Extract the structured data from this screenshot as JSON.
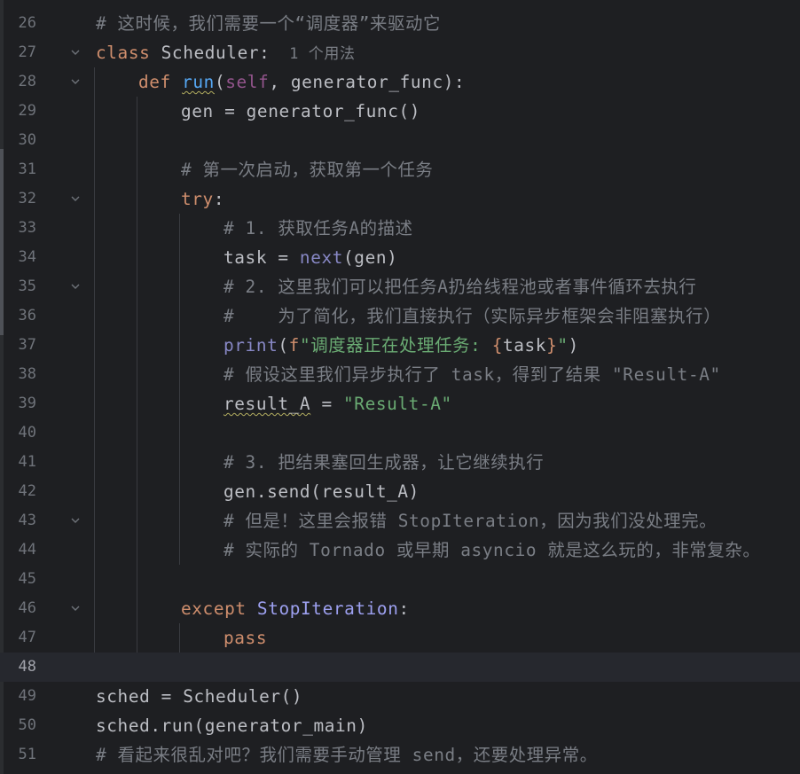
{
  "editor": {
    "lines": [
      {
        "number": "26",
        "fold": false,
        "indent": 0,
        "tokens": [
          {
            "t": "cmt",
            "v": "# 这时候，我们需要一个“调度器”来驱动它"
          }
        ]
      },
      {
        "number": "27",
        "fold": true,
        "indent": 0,
        "tokens": [
          {
            "t": "kw",
            "v": "class "
          },
          {
            "t": "plain",
            "v": "Scheduler:"
          },
          {
            "t": "hint",
            "v": "  1 个用法"
          }
        ]
      },
      {
        "number": "28",
        "fold": true,
        "indent": 1,
        "tokens": [
          {
            "t": "kw",
            "v": "def "
          },
          {
            "t": "fn_u",
            "v": "run"
          },
          {
            "t": "plain",
            "v": "("
          },
          {
            "t": "self",
            "v": "self"
          },
          {
            "t": "plain",
            "v": ", generator_func):"
          }
        ]
      },
      {
        "number": "29",
        "fold": false,
        "indent": 2,
        "tokens": [
          {
            "t": "plain",
            "v": "gen = generator_func()"
          }
        ]
      },
      {
        "number": "30",
        "fold": false,
        "indent": 0,
        "tokens": []
      },
      {
        "number": "31",
        "fold": false,
        "indent": 2,
        "tokens": [
          {
            "t": "cmt",
            "v": "# 第一次启动，获取第一个任务"
          }
        ]
      },
      {
        "number": "32",
        "fold": true,
        "indent": 2,
        "tokens": [
          {
            "t": "kw",
            "v": "try"
          },
          {
            "t": "plain",
            "v": ":"
          }
        ]
      },
      {
        "number": "33",
        "fold": false,
        "indent": 3,
        "tokens": [
          {
            "t": "cmt",
            "v": "# 1. 获取任务A的描述"
          }
        ]
      },
      {
        "number": "34",
        "fold": false,
        "indent": 3,
        "tokens": [
          {
            "t": "plain",
            "v": "task = "
          },
          {
            "t": "builtin",
            "v": "next"
          },
          {
            "t": "plain",
            "v": "(gen)"
          }
        ]
      },
      {
        "number": "35",
        "fold": true,
        "indent": 3,
        "tokens": [
          {
            "t": "cmt",
            "v": "# 2. 这里我们可以把任务A扔给线程池或者事件循环去执行"
          }
        ]
      },
      {
        "number": "36",
        "fold": false,
        "indent": 3,
        "tokens": [
          {
            "t": "cmt",
            "v": "#    为了简化，我们直接执行（实际异步框架会非阻塞执行）"
          }
        ]
      },
      {
        "number": "37",
        "fold": false,
        "indent": 3,
        "tokens": [
          {
            "t": "builtin",
            "v": "print"
          },
          {
            "t": "plain",
            "v": "("
          },
          {
            "t": "kw",
            "v": "f"
          },
          {
            "t": "str",
            "v": "\"调度器正在处理任务: "
          },
          {
            "t": "kw",
            "v": "{"
          },
          {
            "t": "plain",
            "v": "task"
          },
          {
            "t": "kw",
            "v": "}"
          },
          {
            "t": "str",
            "v": "\""
          },
          {
            "t": "plain",
            "v": ")"
          }
        ]
      },
      {
        "number": "38",
        "fold": false,
        "indent": 3,
        "tokens": [
          {
            "t": "cmt",
            "v": "# 假设这里我们异步执行了 task，得到了结果 \"Result-A\""
          }
        ]
      },
      {
        "number": "39",
        "fold": false,
        "indent": 3,
        "tokens": [
          {
            "t": "under",
            "v": "result_A"
          },
          {
            "t": "plain",
            "v": " = "
          },
          {
            "t": "str",
            "v": "\"Result-A\""
          }
        ]
      },
      {
        "number": "40",
        "fold": false,
        "indent": 0,
        "tokens": []
      },
      {
        "number": "41",
        "fold": false,
        "indent": 3,
        "tokens": [
          {
            "t": "cmt",
            "v": "# 3. 把结果塞回生成器，让它继续执行"
          }
        ]
      },
      {
        "number": "42",
        "fold": false,
        "indent": 3,
        "tokens": [
          {
            "t": "plain",
            "v": "gen.send(result_A)"
          }
        ]
      },
      {
        "number": "43",
        "fold": true,
        "indent": 3,
        "tokens": [
          {
            "t": "cmt",
            "v": "# 但是！这里会报错 StopIteration，因为我们没处理完。"
          }
        ]
      },
      {
        "number": "44",
        "fold": false,
        "indent": 3,
        "tokens": [
          {
            "t": "cmt",
            "v": "# 实际的 Tornado 或早期 asyncio 就是这么玩的，非常复杂。"
          }
        ]
      },
      {
        "number": "45",
        "fold": false,
        "indent": 0,
        "tokens": []
      },
      {
        "number": "46",
        "fold": true,
        "indent": 2,
        "tokens": [
          {
            "t": "kw",
            "v": "except "
          },
          {
            "t": "cls",
            "v": "StopIteration"
          },
          {
            "t": "plain",
            "v": ":"
          }
        ]
      },
      {
        "number": "47",
        "fold": false,
        "indent": 3,
        "tokens": [
          {
            "t": "kw",
            "v": "pass"
          }
        ]
      },
      {
        "number": "48",
        "fold": false,
        "indent": 0,
        "current": true,
        "tokens": []
      },
      {
        "number": "49",
        "fold": false,
        "indent": 0,
        "tokens": [
          {
            "t": "plain",
            "v": "sched = Scheduler()"
          }
        ]
      },
      {
        "number": "50",
        "fold": false,
        "indent": 0,
        "tokens": [
          {
            "t": "plain",
            "v": "sched.run(generator_main)"
          }
        ]
      },
      {
        "number": "51",
        "fold": false,
        "indent": 0,
        "tokens": [
          {
            "t": "cmt",
            "v": "# 看起来很乱对吧？我们需要手动管理 send，还要处理异常。"
          }
        ]
      }
    ]
  }
}
